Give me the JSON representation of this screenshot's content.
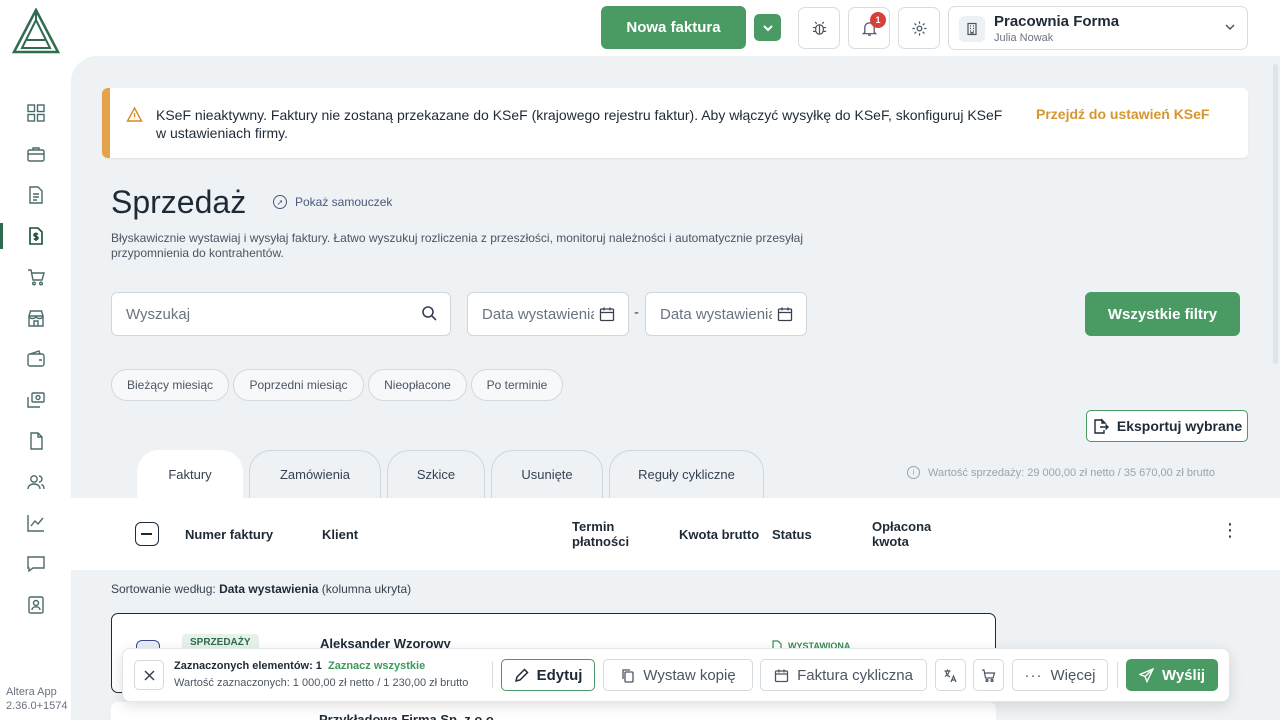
{
  "app": {
    "version_name": "Altera App",
    "version_number": "2.36.0+1574"
  },
  "sidebar": {
    "items": [
      {
        "icon": "dashboard-grid-icon",
        "active": false
      },
      {
        "icon": "briefcase-icon",
        "active": false
      },
      {
        "icon": "document-list-icon",
        "active": false
      },
      {
        "icon": "sales-invoice-icon",
        "active": true
      },
      {
        "icon": "cart-icon",
        "active": false
      },
      {
        "icon": "store-icon",
        "active": false
      },
      {
        "icon": "wallet-icon",
        "active": false
      },
      {
        "icon": "money-transfer-icon",
        "active": false
      },
      {
        "icon": "file-icon",
        "active": false
      },
      {
        "icon": "users-icon",
        "active": false
      },
      {
        "icon": "chart-icon",
        "active": false
      },
      {
        "icon": "message-icon",
        "active": false
      },
      {
        "icon": "contact-card-icon",
        "active": false
      }
    ]
  },
  "topbar": {
    "new_invoice_label": "Nowa faktura",
    "notifications_count": "1",
    "company_name": "Pracownia Forma",
    "user_name": "Julia Nowak"
  },
  "alert": {
    "message": "KSeF nieaktywny. Faktury nie zostaną przekazane do KSeF (krajowego rejestru faktur). Aby włączyć wysyłkę do KSeF, skonfiguruj KSeF w ustawieniach firmy.",
    "link_label": "Przejdź do ustawień KSeF",
    "accent_color": "#e3a34a"
  },
  "page": {
    "title": "Sprzedaż",
    "tutorial_label": "Pokaż samouczek",
    "description": "Błyskawicznie wystawiaj i wysyłaj faktury. Łatwo wyszukuj rozliczenia z przeszłości, monitoruj należności i automatycznie przesyłaj przypomnienia do kontrahentów."
  },
  "filters": {
    "search_placeholder": "Wyszukaj",
    "date_from_placeholder": "Data wystawienia",
    "date_to_placeholder": "Data wystawienia",
    "separator": "-",
    "all_filters_label": "Wszystkie filtry",
    "chips": [
      "Bieżący miesiąc",
      "Poprzedni miesiąc",
      "Nieopłacone",
      "Po terminie"
    ]
  },
  "export_label": "Eksportuj wybrane",
  "tabs": [
    {
      "label": "Faktury",
      "active": true
    },
    {
      "label": "Zamówienia",
      "active": false
    },
    {
      "label": "Szkice",
      "active": false
    },
    {
      "label": "Usunięte",
      "active": false
    },
    {
      "label": "Reguły cykliczne",
      "active": false
    }
  ],
  "sales_value_info": "Wartość sprzedaży: 29 000,00 zł netto / 35 670,00 zł brutto",
  "table": {
    "columns": [
      {
        "label": "Numer faktury"
      },
      {
        "label": "Klient"
      },
      {
        "label": "Termin płatności"
      },
      {
        "label": "Kwota brutto"
      },
      {
        "label": "Status"
      },
      {
        "label": "Opłacona kwota"
      }
    ],
    "sorting_prefix": "Sortowanie według:",
    "sorting_field": "Data wystawienia",
    "sorting_suffix": "(kolumna ukryta)",
    "rows": [
      {
        "type_badge": "SPRZEDAŻY",
        "client": "Aleksander Wzorowy",
        "status": "WYSTAWIONA",
        "selected": true
      },
      {
        "client": "Przykładowa Firma Sp. z o.o."
      }
    ]
  },
  "actionbar": {
    "selected_label": "Zaznaczonych elementów: 1",
    "select_all_label": "Zaznacz wszystkie",
    "selected_value": "Wartość zaznaczonych: 1 000,00 zł netto / 1 230,00 zł brutto",
    "edit_label": "Edytuj",
    "copy_label": "Wystaw kopię",
    "recurring_label": "Faktura cykliczna",
    "more_label": "Więcej",
    "send_label": "Wyślij"
  },
  "colors": {
    "primary_green": "#4a9a63",
    "main_background": "#eef2f4",
    "badge_red": "#d6403a"
  }
}
